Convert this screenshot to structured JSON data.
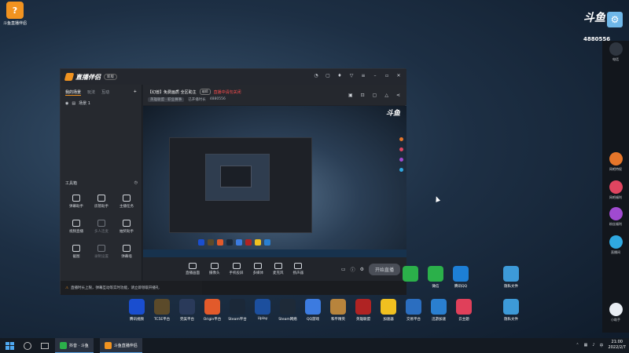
{
  "desktop": {
    "top_app_label": "斗鱼直播伴侣",
    "bottom_apps": [
      {
        "label": "腾讯视频",
        "color": "#1a4ecf"
      },
      {
        "label": "TC5E平台",
        "color": "#5b4a2a"
      },
      {
        "label": "完美平台",
        "color": "#2a3a5a"
      },
      {
        "label": "Origin平台",
        "color": "#e25a2b"
      },
      {
        "label": "Steam平台",
        "color": "#1b2838"
      },
      {
        "label": "Uplay",
        "color": "#1c4f9e"
      },
      {
        "label": "Steam网络",
        "color": "#1e2a38"
      },
      {
        "label": "QQ游戏",
        "color": "#3c7be0"
      },
      {
        "label": "和平精英",
        "color": "#b8843c"
      },
      {
        "label": "英雄联盟",
        "color": "#b02323"
      },
      {
        "label": "加速器",
        "color": "#f0c020"
      },
      {
        "label": "交易平台",
        "color": "#2b6ec0"
      },
      {
        "label": "迅游加速",
        "color": "#2a7fd0"
      },
      {
        "label": "云主题",
        "color": "#e0405a"
      },
      {
        "label": "隐私文件",
        "color": "#3d9ad8"
      }
    ],
    "right_apps": [
      {
        "label": "",
        "color": "#2bb04a"
      },
      {
        "label": "微信",
        "color": "#2bb04a"
      },
      {
        "label": "腾讯QQ",
        "color": "#1d7fd6"
      },
      {
        "label": "隐私文件",
        "color": "#3d9ad8"
      }
    ]
  },
  "streamer_window": {
    "brand": "直播伴侣",
    "version": "新版",
    "sidebar_tabs": [
      "我的场景",
      "玩法",
      "互动"
    ],
    "scene_name": "场景 1",
    "toolbox_title": "工具箱",
    "tools": [
      {
        "label": "弹幕助手",
        "dim": false
      },
      {
        "label": "房管助手",
        "dim": false
      },
      {
        "label": "主播任务",
        "dim": false
      },
      {
        "label": "视频直播",
        "dim": false
      },
      {
        "label": "多人连麦",
        "dim": true
      },
      {
        "label": "抽奖助手",
        "dim": false
      },
      {
        "label": "截图",
        "dim": false
      },
      {
        "label": "录制设置",
        "dim": true
      },
      {
        "label": "弹幕墙",
        "dim": false
      }
    ],
    "notice": "直播时长上限，弹幕互动等实时功能，请立即领取开播礼",
    "room_title": "【幻兽】免费画质 全区助主",
    "room_pill": "编辑",
    "room_status_red": "直播中请勿关闭",
    "room_meta_tag": "英雄联盟 · 职业赛事",
    "room_meta_text": "已开播时长",
    "room_meta_count": "4880556",
    "controls": [
      {
        "label": "直播画面"
      },
      {
        "label": "摄像头"
      },
      {
        "label": "手机投屏"
      },
      {
        "label": "多媒体"
      },
      {
        "label": "麦克风"
      },
      {
        "label": "扬声器"
      }
    ],
    "start_button": "开始直播"
  },
  "overlay": {
    "logo": "斗鱼",
    "room_number": "4880556"
  },
  "right_panel": {
    "buttons": [
      {
        "label": "电话",
        "color": "#2f3640"
      },
      {
        "label": "网吧特权",
        "color": "#e6762a"
      },
      {
        "label": "网吧福利",
        "color": "#e04560"
      },
      {
        "label": "粉丝福利",
        "color": "#a04ad0"
      },
      {
        "label": "直播间",
        "color": "#2fa8e0"
      },
      {
        "label": "小助手",
        "color": "#e8edf3"
      }
    ]
  },
  "taskbar": {
    "items": [
      {
        "label": "抖音 · 斗鱼",
        "color": "#2bb04a"
      },
      {
        "label": "斗鱼直播伴侣",
        "color": "#f19320"
      }
    ],
    "time": "21:00",
    "date": "2022/2/7"
  }
}
